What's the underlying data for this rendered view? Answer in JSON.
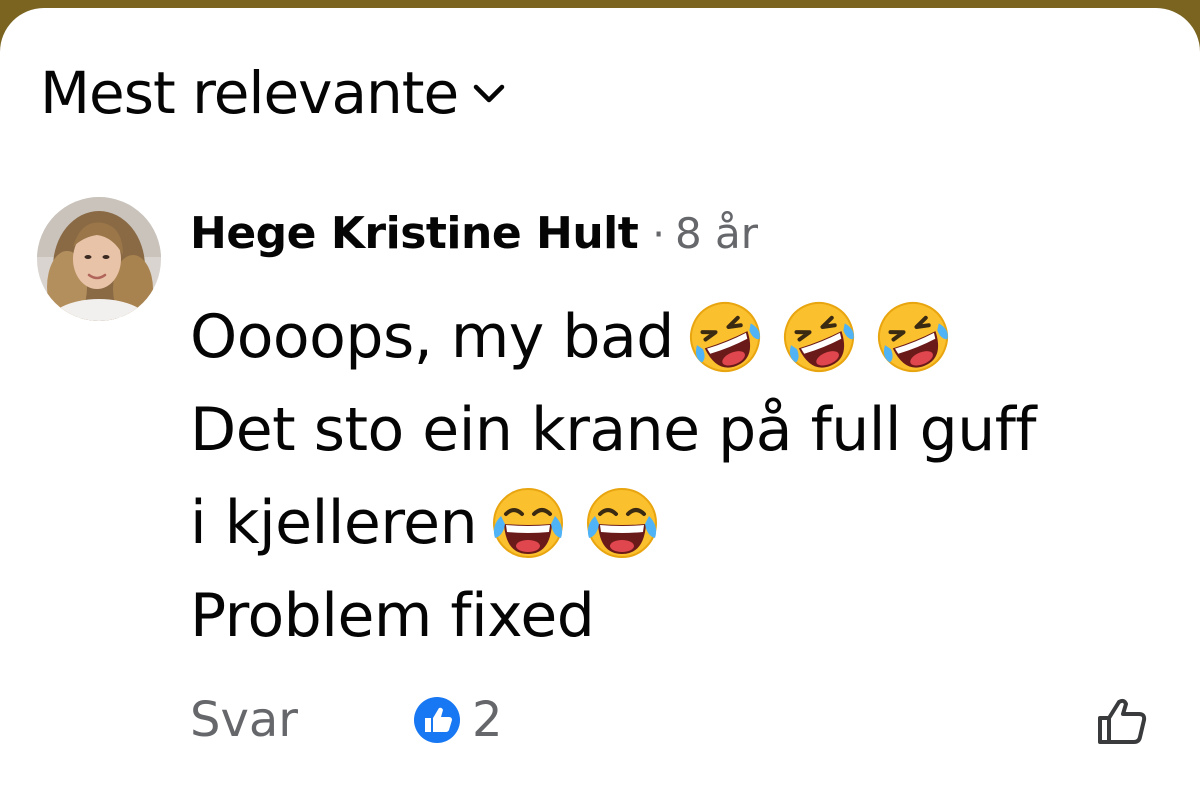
{
  "sort": {
    "label": "Mest relevante",
    "icon": "chevron-down-icon"
  },
  "comment": {
    "author": "Hege Kristine Hult",
    "separator": "·",
    "time": "8 år",
    "lines": [
      {
        "text": "Oooops, my bad",
        "emoji": [
          "rolling-on-floor-laughing",
          "rolling-on-floor-laughing",
          "rolling-on-floor-laughing"
        ]
      },
      {
        "text": "Det sto ein krane på full guff",
        "emoji": []
      },
      {
        "text": "i kjelleren",
        "emoji": [
          "face-with-tears-of-joy",
          "face-with-tears-of-joy"
        ]
      },
      {
        "text": "Problem fixed",
        "emoji": []
      }
    ],
    "actions": {
      "reply_label": "Svar",
      "reaction_icon": "like-badge-icon",
      "reaction_count": "2",
      "like_icon": "thumbs-up-outline-icon"
    }
  },
  "colors": {
    "text_primary": "#050505",
    "text_secondary": "#65676b",
    "like_blue": "#1877f2",
    "emoji_yellow": "#fbc02d",
    "background_top": "#7a6420"
  }
}
